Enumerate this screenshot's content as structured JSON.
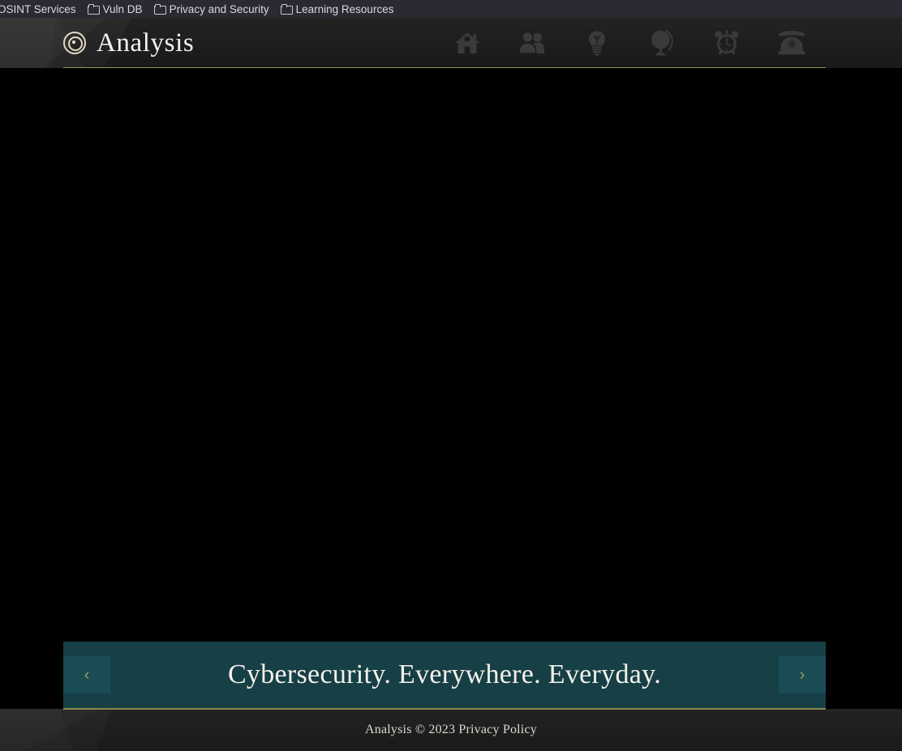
{
  "browser": {
    "bookmarks": [
      {
        "label": "OSINT Services",
        "icon": "",
        "has_folder_icon": false
      },
      {
        "label": "Vuln DB",
        "icon": "folder-icon",
        "has_folder_icon": true
      },
      {
        "label": "Privacy and Security",
        "icon": "folder-icon",
        "has_folder_icon": true
      },
      {
        "label": "Learning Resources",
        "icon": "folder-icon",
        "has_folder_icon": true
      }
    ]
  },
  "header": {
    "brand_name": "Analysis",
    "brand_logo_icon": "target-rings-icon",
    "nav": [
      {
        "label": "Home",
        "icon": "home-icon"
      },
      {
        "label": "People",
        "icon": "users-icon"
      },
      {
        "label": "Ideas",
        "icon": "lightbulb-icon"
      },
      {
        "label": "Global",
        "icon": "globe-icon"
      },
      {
        "label": "Alerts",
        "icon": "alarm-clock-icon"
      },
      {
        "label": "Contact",
        "icon": "telephone-icon"
      }
    ]
  },
  "hero": {
    "caption": "Cybersecurity. Everywhere. Everyday.",
    "prev_label": "‹",
    "next_label": "›",
    "prev_icon": "chevron-left-icon",
    "next_icon": "chevron-right-icon"
  },
  "footer": {
    "text": "Analysis © 2023 Privacy Policy"
  },
  "colors": {
    "accent_olive": "#8b9a4b",
    "banner_teal": "#163f46",
    "arrow_teal": "#1a4c55",
    "chrome_dark": "#2b2a33",
    "chrome_panel": "#1d1d1d",
    "logo_tan": "#e3d9c2",
    "stage_black": "#000000",
    "nav_icon_gray": "#3a3a3a"
  }
}
